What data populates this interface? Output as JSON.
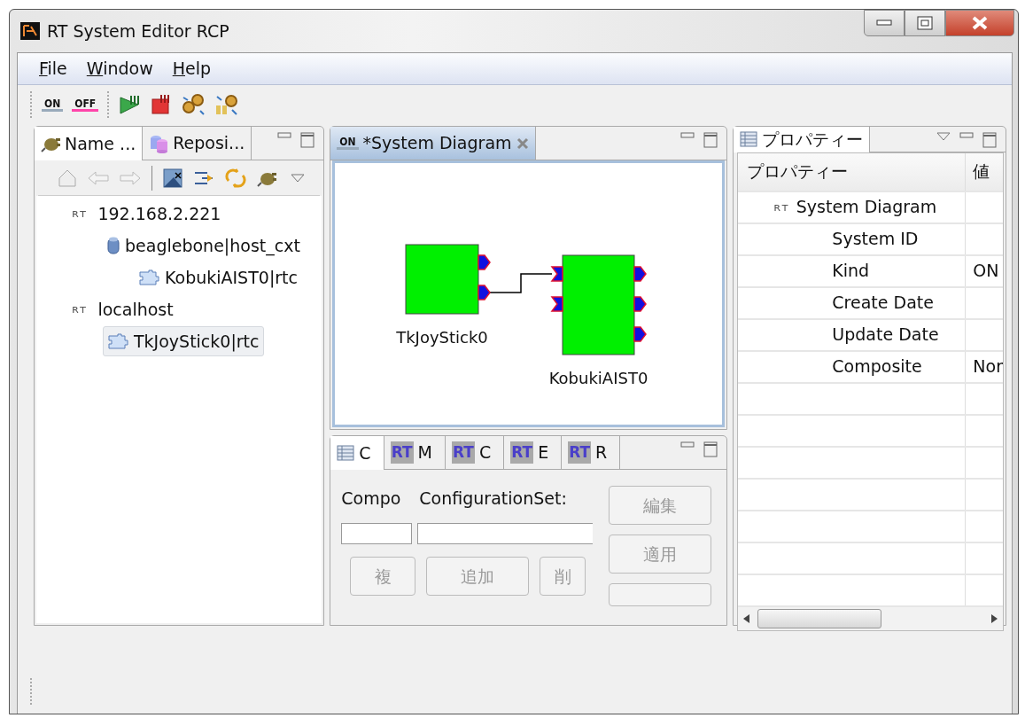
{
  "window": {
    "title": "RT System Editor RCP"
  },
  "menu": [
    {
      "label": "File"
    },
    {
      "label": "Window"
    },
    {
      "label": "Help"
    }
  ],
  "toolbar": [
    {
      "kind": "on",
      "label": "ON"
    },
    {
      "kind": "off",
      "label": "OFF"
    },
    {
      "kind": "start"
    },
    {
      "kind": "stop"
    },
    {
      "kind": "gears"
    },
    {
      "kind": "gears-box"
    }
  ],
  "left_panel": {
    "tabs": [
      {
        "label": "Name ...",
        "kind": "plug",
        "selected": true
      },
      {
        "label": "Reposi...",
        "kind": "repo",
        "selected": false
      }
    ],
    "tree": [
      {
        "label": "192.168.2.221",
        "kind": "host",
        "logo": "ʀт",
        "selected": false,
        "children": [
          {
            "label": "beaglebone|host_cxt",
            "kind": "context",
            "selected": false,
            "children": [
              {
                "label": "KobukiAIST0|rtc",
                "kind": "component",
                "selected": false
              }
            ]
          }
        ]
      },
      {
        "label": "localhost",
        "kind": "host",
        "logo": "ʀт",
        "selected": false,
        "children": [
          {
            "label": "TkJoyStick0|rtc",
            "kind": "component",
            "selected": true
          }
        ]
      }
    ]
  },
  "editor": {
    "tab": {
      "label": "*System Diagram",
      "icon_label": "ON"
    },
    "components": [
      {
        "name": "TkJoyStick0"
      },
      {
        "name": "KobukiAIST0"
      }
    ]
  },
  "bottom_panel": {
    "tabs": [
      {
        "label": "C",
        "kind": "table",
        "selected": true
      },
      {
        "label": "M",
        "kind": "rt",
        "badge": "RT",
        "selected": false
      },
      {
        "label": "C",
        "kind": "rt",
        "badge": "RT",
        "selected": false
      },
      {
        "label": "E",
        "kind": "rt",
        "badge": "RT",
        "selected": false
      },
      {
        "label": "R",
        "kind": "rt",
        "badge": "RT",
        "selected": false
      }
    ],
    "labels": [
      "Compo",
      "ConfigurationSet:"
    ],
    "buttons": [
      {
        "label": "複",
        "disabled": true
      },
      {
        "label": "追加",
        "disabled": true
      },
      {
        "label": "削",
        "disabled": true
      }
    ],
    "side_buttons": [
      {
        "label": "編集",
        "disabled": true
      },
      {
        "label": "適用",
        "disabled": true
      },
      {
        "disabled": true
      }
    ]
  },
  "properties": {
    "tab": {
      "label": "プロパティー"
    },
    "columns": [
      "プロパティー",
      "値"
    ],
    "rows": [
      {
        "property": "System Diagram",
        "kind": "category",
        "logo": "ʀт"
      },
      {
        "property": "System ID",
        "kind": "field"
      },
      {
        "property": "Kind",
        "kind": "field",
        "value": "ON"
      },
      {
        "property": "Create Date",
        "kind": "field"
      },
      {
        "property": "Update Date",
        "kind": "field"
      },
      {
        "property": "Composite",
        "kind": "field",
        "value": "Nor"
      }
    ]
  }
}
